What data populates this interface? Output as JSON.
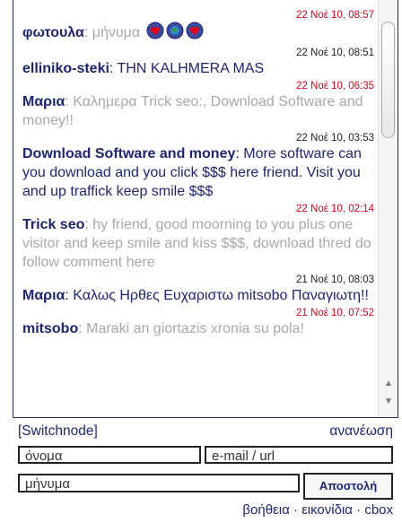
{
  "messages": [
    {
      "time": "22 Νοέ 10, 08:57",
      "time_color": "red",
      "name": "φωτουλα",
      "text": "μήνυμα",
      "text_style": "gray",
      "emoji": true
    },
    {
      "time": "22 Νοέ 10, 08:51",
      "time_color": "black",
      "name": "elliniko-steki",
      "text": "THN KALHMERA MAS",
      "text_style": "navy"
    },
    {
      "time": "22 Νοέ 10, 06:35",
      "time_color": "red",
      "name": "Μαρια",
      "text": "Καλημερα Trick seo:, Download Software and money!!",
      "text_style": "gray"
    },
    {
      "time": "22 Νοέ 10, 03:53",
      "time_color": "black",
      "name": "Download Software and money",
      "text": "More software can you download and you click $$$ here friend. Visit you and up traffick keep smile $$$",
      "text_style": "navy"
    },
    {
      "time": "22 Νοέ 10, 02:14",
      "time_color": "red",
      "name": "Trick seo",
      "text": "hy friend, good moorning to you plus one visitor and keep smile and kiss $$$, download thred do follow comment here",
      "text_style": "gray"
    },
    {
      "time": "21 Νοέ 10, 08:03",
      "time_color": "black",
      "name": "Μαρια",
      "text": "Καλως Ηρθες Ευχαριστω mitsobo Παναγιωτη!!",
      "text_style": "navy"
    },
    {
      "time": "21 Νοέ 10, 07:52",
      "time_color": "red",
      "name": "mitsobo",
      "text": "Maraki an giortazis xronia su pola!",
      "text_style": "gray"
    }
  ],
  "controls": {
    "switch_label": "[Switchnode]",
    "refresh_label": "ανανέωση",
    "name_placeholder": "όνομα",
    "url_placeholder": "e-mail / url",
    "message_placeholder": "μήνυμα",
    "send_label": "Αποστολή"
  },
  "footer": {
    "help": "βοήθεια",
    "smilies": "εικονίδια",
    "cbox": "cbox",
    "separator": "·"
  },
  "colors": {
    "accent": "#1e2670",
    "timestamp_red": "#e0001b",
    "muted": "#a8a8a8"
  }
}
